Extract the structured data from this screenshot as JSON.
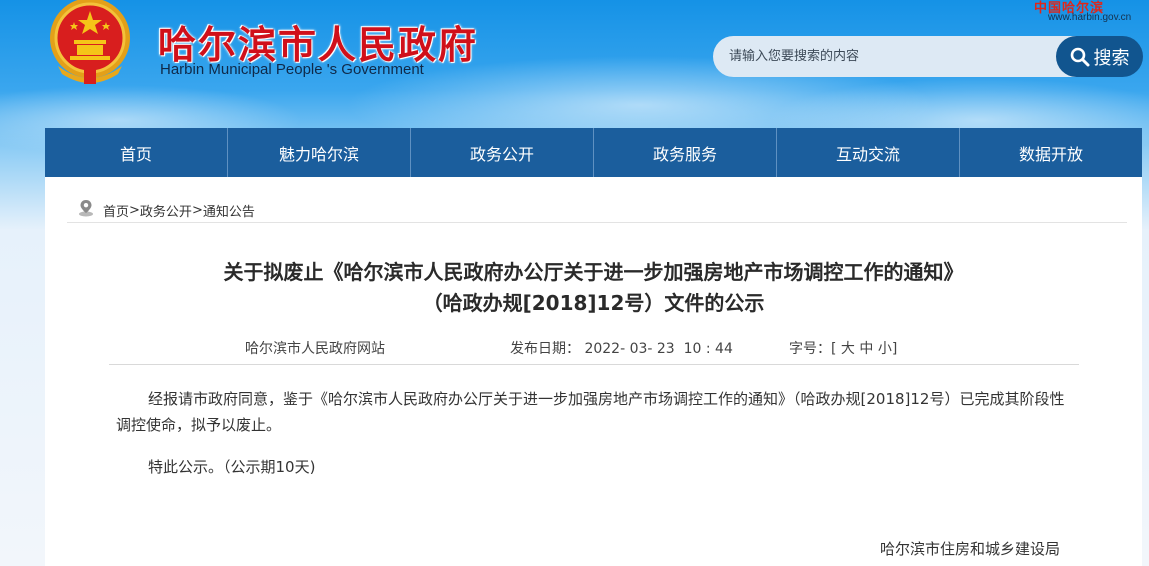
{
  "header": {
    "site_title": "哈尔滨市人民政府",
    "site_subtitle": "Harbin Municipal People 's Government",
    "brand_mark": "中国哈尔滨",
    "domain": "www.harbin.gov.cn"
  },
  "search": {
    "placeholder": "请输入您要搜索的内容",
    "button_label": "搜索"
  },
  "nav": {
    "items": [
      "首页",
      "魅力哈尔滨",
      "政务公开",
      "政务服务",
      "互动交流",
      "数据开放"
    ]
  },
  "breadcrumb": {
    "items": [
      "首页",
      "政务公开",
      "通知公告"
    ],
    "separator": ">"
  },
  "article": {
    "title_line1": "关于拟废止《哈尔滨市人民政府办公厅关于进一步加强房地产市场调控工作的通知》",
    "title_line2": "（哈政办规[2018]12号）文件的公示",
    "source": "哈尔滨市人民政府网站",
    "date_label": "发布日期：",
    "date_value": "2022- 03- 23  10 : 44",
    "font_label": "字号：",
    "font_open": "[",
    "font_large": "大",
    "font_medium": "中",
    "font_small": "小",
    "font_close": "]",
    "paragraph1": "经报请市政府同意，鉴于《哈尔滨市人民政府办公厅关于进一步加强房地产市场调控工作的通知》（哈政办规[2018]12号）已完成其阶段性调控使命，拟予以废止。",
    "paragraph2": "特此公示。（公示期10天)",
    "signature": "哈尔滨市住房和城乡建设局"
  },
  "colors": {
    "title_red": "#d0101a",
    "nav_blue": "#1b5e9d",
    "search_button": "#11558f",
    "sky_top": "#1592e6"
  }
}
